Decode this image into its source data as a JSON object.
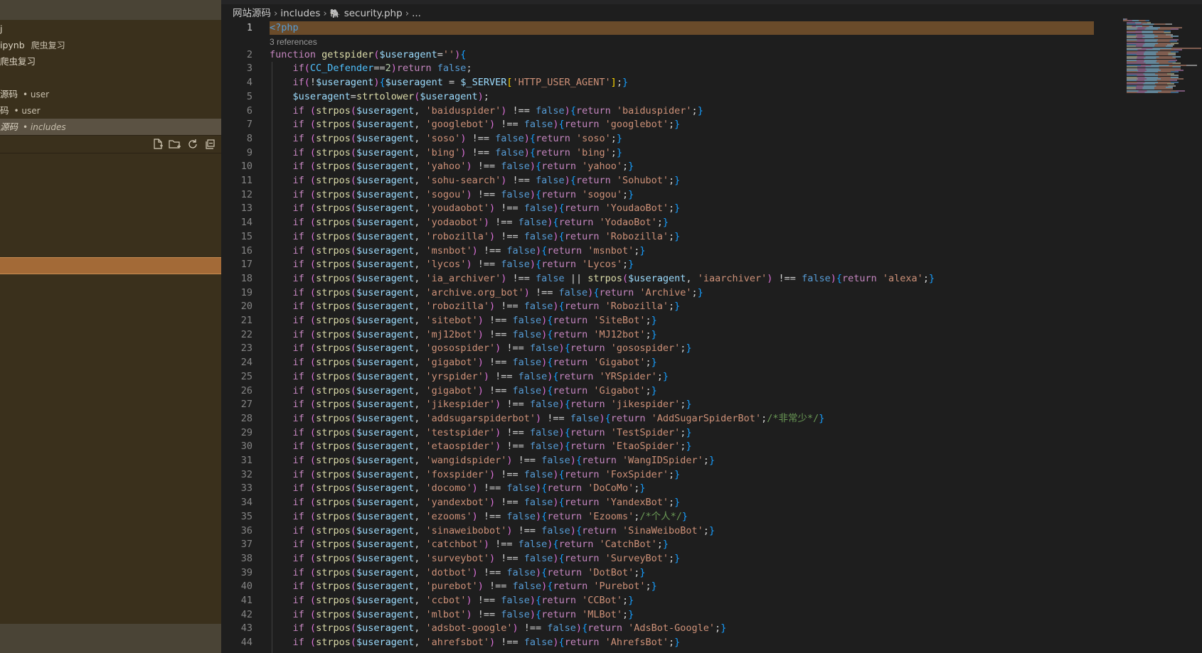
{
  "sidebar": {
    "items": [
      {
        "label": "j",
        "detail": ""
      },
      {
        "label": "ipynb",
        "detail": "爬虫复习"
      },
      {
        "label": "爬虫复习",
        "detail": ""
      },
      {
        "label": "源码",
        "detail": "• user"
      },
      {
        "label": "码",
        "detail": "• user"
      },
      {
        "label": "源码",
        "detail": "• includes"
      }
    ],
    "toolbar": [
      "new-file-icon",
      "new-folder-icon",
      "refresh-icon",
      "collapse-all-icon"
    ]
  },
  "breadcrumb": {
    "parts": [
      "网站源码",
      "includes",
      "security.php",
      "..."
    ]
  },
  "editor": {
    "references": "3 references",
    "lines": [
      "<?php",
      "function getspider($useragent=''){",
      "    if(CC_Defender==2)return false;",
      "    if(!$useragent){$useragent = $_SERVER['HTTP_USER_AGENT'];}",
      "    $useragent=strtolower($useragent);",
      "    if (strpos($useragent, 'baiduspider') !== false){return 'baiduspider';}",
      "    if (strpos($useragent, 'googlebot') !== false){return 'googlebot';}",
      "    if (strpos($useragent, 'soso') !== false){return 'soso';}",
      "    if (strpos($useragent, 'bing') !== false){return 'bing';}",
      "    if (strpos($useragent, 'yahoo') !== false){return 'yahoo';}",
      "    if (strpos($useragent, 'sohu-search') !== false){return 'Sohubot';}",
      "    if (strpos($useragent, 'sogou') !== false){return 'sogou';}",
      "    if (strpos($useragent, 'youdaobot') !== false){return 'YoudaoBot';}",
      "    if (strpos($useragent, 'yodaobot') !== false){return 'YodaoBot';}",
      "    if (strpos($useragent, 'robozilla') !== false){return 'Robozilla';}",
      "    if (strpos($useragent, 'msnbot') !== false){return 'msnbot';}",
      "    if (strpos($useragent, 'lycos') !== false){return 'Lycos';}",
      "    if (strpos($useragent, 'ia_archiver') !== false || strpos($useragent, 'iaarchiver') !== false){return 'alexa';}",
      "    if (strpos($useragent, 'archive.org_bot') !== false){return 'Archive';}",
      "    if (strpos($useragent, 'robozilla') !== false){return 'Robozilla';}",
      "    if (strpos($useragent, 'sitebot') !== false){return 'SiteBot';}",
      "    if (strpos($useragent, 'mj12bot') !== false){return 'MJ12bot';}",
      "    if (strpos($useragent, 'gosospider') !== false){return 'gosospider';}",
      "    if (strpos($useragent, 'gigabot') !== false){return 'Gigabot';}",
      "    if (strpos($useragent, 'yrspider') !== false){return 'YRSpider';}",
      "    if (strpos($useragent, 'gigabot') !== false){return 'Gigabot';}",
      "    if (strpos($useragent, 'jikespider') !== false){return 'jikespider';}",
      "    if (strpos($useragent, 'addsugarspiderbot') !== false){return 'AddSugarSpiderBot';/*非常少*/}",
      "    if (strpos($useragent, 'testspider') !== false){return 'TestSpider';}",
      "    if (strpos($useragent, 'etaospider') !== false){return 'EtaoSpider';}",
      "    if (strpos($useragent, 'wangidspider') !== false){return 'WangIDSpider';}",
      "    if (strpos($useragent, 'foxspider') !== false){return 'FoxSpider';}",
      "    if (strpos($useragent, 'docomo') !== false){return 'DoCoMo';}",
      "    if (strpos($useragent, 'yandexbot') !== false){return 'YandexBot';}",
      "    if (strpos($useragent, 'ezooms') !== false){return 'Ezooms';/*个人*/}",
      "    if (strpos($useragent, 'sinaweibobot') !== false){return 'SinaWeiboBot';}",
      "    if (strpos($useragent, 'catchbot') !== false){return 'CatchBot';}",
      "    if (strpos($useragent, 'surveybot') !== false){return 'SurveyBot';}",
      "    if (strpos($useragent, 'dotbot') !== false){return 'DotBot';}",
      "    if (strpos($useragent, 'purebot') !== false){return 'Purebot';}",
      "    if (strpos($useragent, 'ccbot') !== false){return 'CCBot';}",
      "    if (strpos($useragent, 'mlbot') !== false){return 'MLBot';}",
      "    if (strpos($useragent, 'adsbot-google') !== false){return 'AdsBot-Google';}",
      "    if (strpos($useragent, 'ahrefsbot') !== false){return 'AhrefsBot';}"
    ]
  },
  "colors": {
    "sidebar_bg": "#3a301c",
    "highlight_orange": "#a36a37",
    "editor_bg": "#1e1e1e",
    "line1_highlight": "#6a4b2a"
  }
}
